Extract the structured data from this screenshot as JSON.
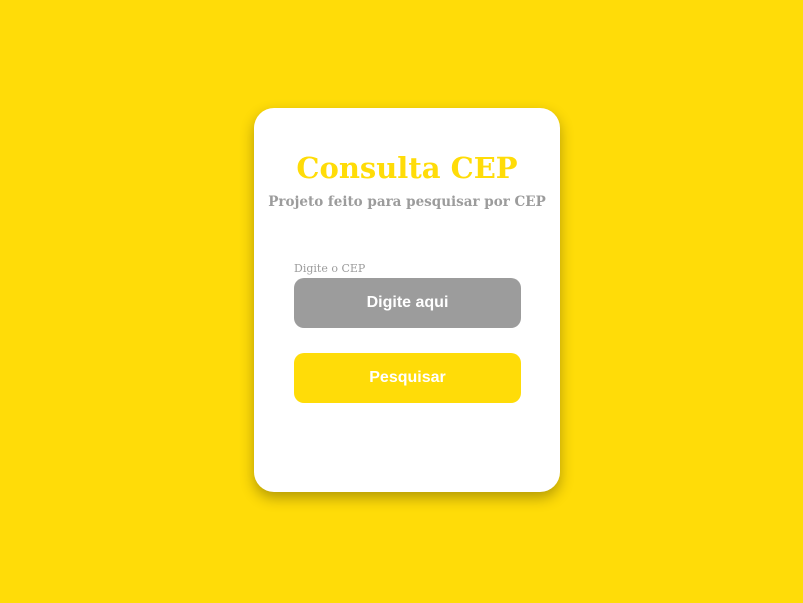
{
  "colors": {
    "background": "#FFDC08",
    "card": "#FFFFFF",
    "accent": "#FFDC08",
    "muted_gray": "#9C9C9C",
    "button_text": "#FFFFFF"
  },
  "card": {
    "title": "Consulta CEP",
    "subtitle": "Projeto feito para pesquisar por CEP"
  },
  "form": {
    "field_label": "Digite o CEP",
    "input_value": "",
    "input_placeholder": "Digite aqui",
    "button_label": "Pesquisar"
  }
}
